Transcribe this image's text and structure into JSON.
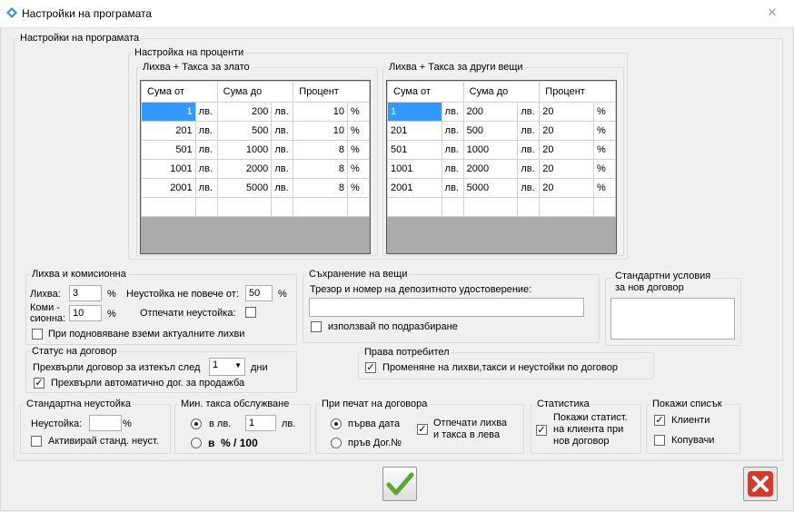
{
  "window": {
    "title": "Настройки на програмата"
  },
  "main_group": "Настройки на програмата",
  "percent_group": "Настройка на проценти",
  "gold": {
    "title": "Лихва + Такса за злато",
    "headers": [
      "Сума от",
      "Сума до",
      "Процент"
    ],
    "rows": [
      {
        "from": "1",
        "cur1": "лв.",
        "to": "200",
        "cur2": "лв.",
        "pct": "10",
        "sign": "%"
      },
      {
        "from": "201",
        "cur1": "лв.",
        "to": "500",
        "cur2": "лв.",
        "pct": "10",
        "sign": "%"
      },
      {
        "from": "501",
        "cur1": "лв.",
        "to": "1000",
        "cur2": "лв.",
        "pct": "8",
        "sign": "%"
      },
      {
        "from": "1001",
        "cur1": "лв.",
        "to": "2000",
        "cur2": "лв.",
        "pct": "8",
        "sign": "%"
      },
      {
        "from": "2001",
        "cur1": "лв.",
        "to": "5000",
        "cur2": "лв.",
        "pct": "8",
        "sign": "%"
      }
    ]
  },
  "other": {
    "title": "Лихва + Такса за други вещи",
    "headers": [
      "Сума от",
      "Сума до",
      "Процент"
    ],
    "rows": [
      {
        "from": "1",
        "cur1": "лв.",
        "to": "200",
        "cur2": "лв.",
        "pct": "20",
        "sign": "%"
      },
      {
        "from": "201",
        "cur1": "лв.",
        "to": "500",
        "cur2": "лв.",
        "pct": "20",
        "sign": "%"
      },
      {
        "from": "501",
        "cur1": "лв.",
        "to": "1000",
        "cur2": "лв.",
        "pct": "20",
        "sign": "%"
      },
      {
        "from": "1001",
        "cur1": "лв.",
        "to": "2000",
        "cur2": "лв.",
        "pct": "20",
        "sign": "%"
      },
      {
        "from": "2001",
        "cur1": "лв.",
        "to": "5000",
        "cur2": "лв.",
        "pct": "20",
        "sign": "%"
      }
    ]
  },
  "interest": {
    "title": "Лихва и комисионна",
    "interest_label": "Лихва:",
    "interest_value": "3",
    "commission_label": "Коми -\nсионна:",
    "commission_value": "10",
    "pct": "%",
    "penalty_label": "Неустойка не повече от:",
    "penalty_value": "50",
    "print_penalty_label": "Отпечати неустойка:",
    "renew_label": "При подновяване вземи актуалните лихви"
  },
  "storage": {
    "title": "Съхранение на вещи",
    "label": "Трезор и номер на депозитното удостоверение:",
    "value": "",
    "default_label": "използвай по подразбиране"
  },
  "standard_terms": {
    "title": "Стандартни условия\nза нов договор",
    "value": ""
  },
  "status": {
    "title": "Статус на договор",
    "move_label": "Прехвърли договор за изтекъл след",
    "move_value": "1",
    "days": "дни",
    "auto_label": "Прехвърли автоматично дог. за продажба"
  },
  "rights": {
    "title": "Права потребител",
    "label": "Променяне на лихви,такси и неустойки по договор"
  },
  "std_penalty": {
    "title": "Стандартна неустойка",
    "label": "Неустойка:",
    "value": "",
    "pct": "%",
    "activate_label": "Активирай станд. неуст."
  },
  "min_fee": {
    "title": "Мин. такса обслужване",
    "in_lv": "в лв.",
    "value": "1",
    "lv": "лв.",
    "pct_label": "в  % / 100"
  },
  "print": {
    "title": "При печат на договора",
    "first_date": "първа дата",
    "first_no": "пръв Дог.№",
    "print_interest": "Отпечати лихва\nи такса в лева"
  },
  "stats": {
    "title": "Статистика",
    "label": "Покажи статист.\nна клиента при\nнов договор"
  },
  "show_list": {
    "title": "Покажи списък",
    "clients": "Клиенти",
    "buyers": "Копувачи"
  },
  "colors": {
    "selection": "#3399ff",
    "ok_green": "#5aa832",
    "cancel_red": "#d8372a"
  }
}
